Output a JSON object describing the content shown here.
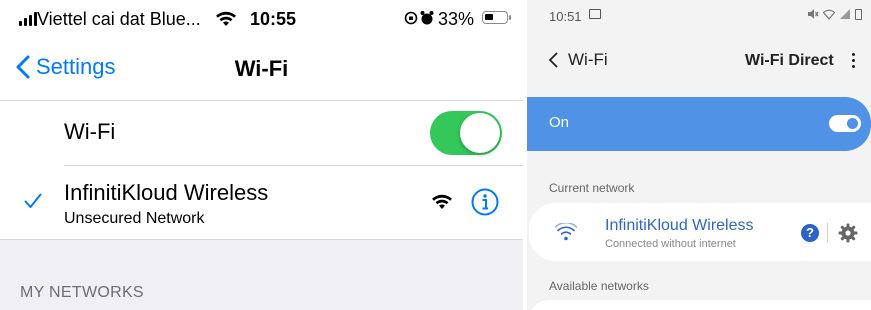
{
  "ios": {
    "status": {
      "carrier": "Viettel cai dat Blue...",
      "time": "10:55",
      "battery": "33%"
    },
    "nav": {
      "back_label": "Settings",
      "title": "Wi-Fi"
    },
    "wifi_toggle": {
      "label": "Wi-Fi",
      "state": "on",
      "color": "#34c759"
    },
    "current_network": {
      "name": "InfinitiKloud Wireless",
      "subtitle": "Unsecured Network"
    },
    "section_header": "MY NETWORKS",
    "accent_color": "#007aff"
  },
  "android": {
    "status": {
      "time": "10:51"
    },
    "nav": {
      "back_label": "Wi-Fi",
      "wifi_direct": "Wi-Fi Direct"
    },
    "on_bar": {
      "label": "On",
      "state": "on",
      "color": "#4f92e6"
    },
    "current_header": "Current network",
    "current_network": {
      "name": "InfinitiKloud Wireless",
      "subtitle": "Connected without internet"
    },
    "available_header": "Available networks"
  }
}
